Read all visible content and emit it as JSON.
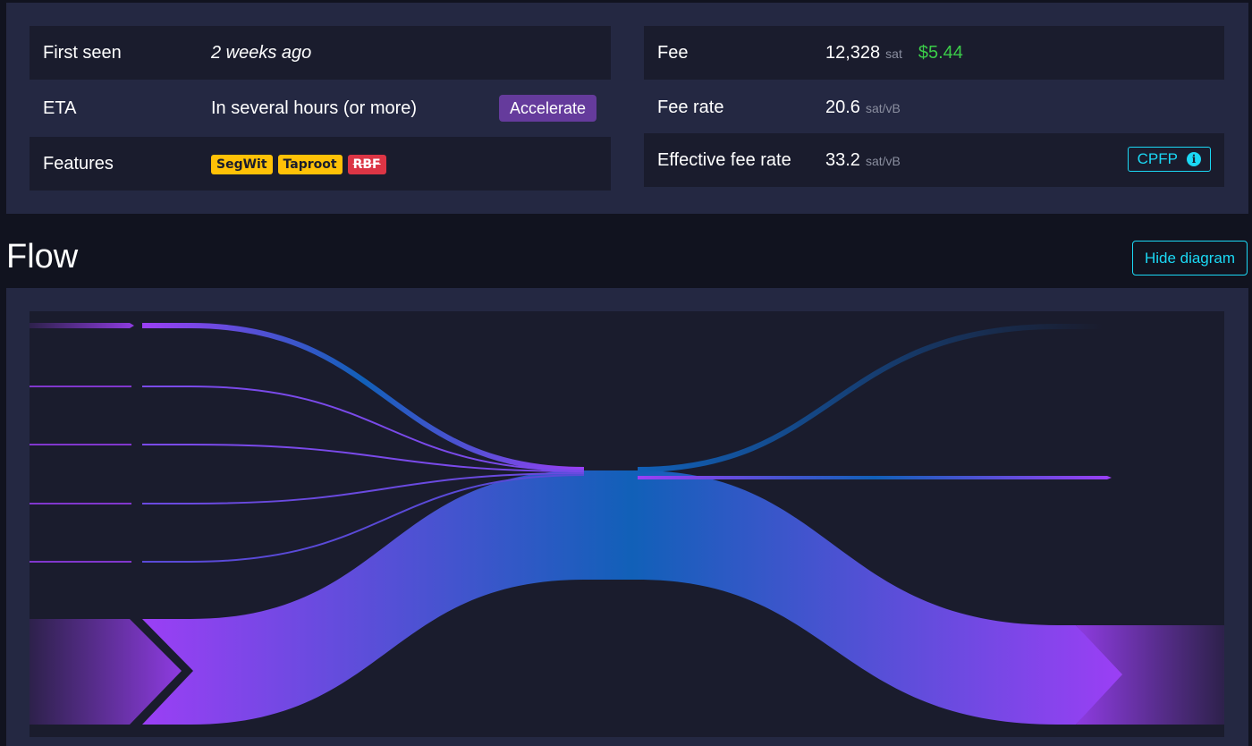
{
  "left_table": {
    "rows": [
      {
        "label": "First seen",
        "value": "2 weeks ago"
      },
      {
        "label": "ETA",
        "value": "In several hours (or more)",
        "button": "Accelerate"
      },
      {
        "label": "Features",
        "badges": [
          {
            "text": "SegWit",
            "color": "#ffc107"
          },
          {
            "text": "Taproot",
            "color": "#ffc107"
          },
          {
            "text": "RBF",
            "color": "#dc3545",
            "strikethrough": true
          }
        ]
      }
    ]
  },
  "right_table": {
    "fee": {
      "label": "Fee",
      "value": "12,328",
      "unit": "sat",
      "fiat": "$5.44"
    },
    "fee_rate": {
      "label": "Fee rate",
      "value": "20.6",
      "unit": "sat/vB"
    },
    "effective_fee_rate": {
      "label": "Effective fee rate",
      "value": "33.2",
      "unit": "sat/vB",
      "button": "CPFP",
      "button_icon": "info-circle-icon"
    }
  },
  "flow": {
    "title": "Flow",
    "hide_button": "Hide diagram",
    "inputs_count": 6,
    "outputs_count": 3
  },
  "colors": {
    "accent_purple": "#9b3ff5",
    "accent_blue": "#1160b8",
    "link_cyan": "#1bd8f4",
    "fiat_green": "#3bcc49",
    "accelerate_purple": "#653b9c"
  }
}
